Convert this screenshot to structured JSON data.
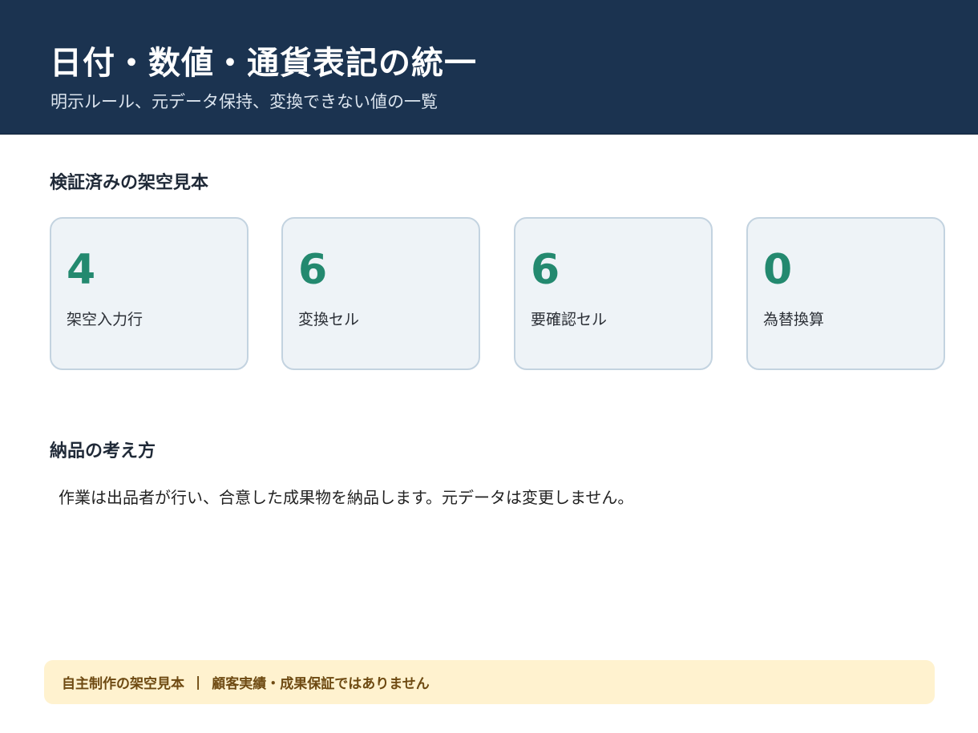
{
  "header": {
    "title": "日付・数値・通貨表記の統一",
    "subtitle": "明示ルール、元データ保持、変換できない値の一覧"
  },
  "samples": {
    "title": "検証済みの架空見本",
    "stats": [
      {
        "value": "4",
        "label": "架空入力行"
      },
      {
        "value": "6",
        "label": "変換セル"
      },
      {
        "value": "6",
        "label": "要確認セル"
      },
      {
        "value": "0",
        "label": "為替換算"
      }
    ]
  },
  "delivery": {
    "title": "納品の考え方",
    "text": "作業は出品者が行い、合意した成果物を納品します。元データは変更しません。"
  },
  "disclaimer": {
    "left": "自主制作の架空見本",
    "separator": "|",
    "right": "顧客実績・成果保証ではありません"
  },
  "colors": {
    "header_bg": "#1b3350",
    "accent": "#23896f",
    "card_bg": "#eef3f7",
    "card_border": "#c3d3e0",
    "notice_bg": "#fff2cf",
    "notice_text": "#6e4a12"
  }
}
